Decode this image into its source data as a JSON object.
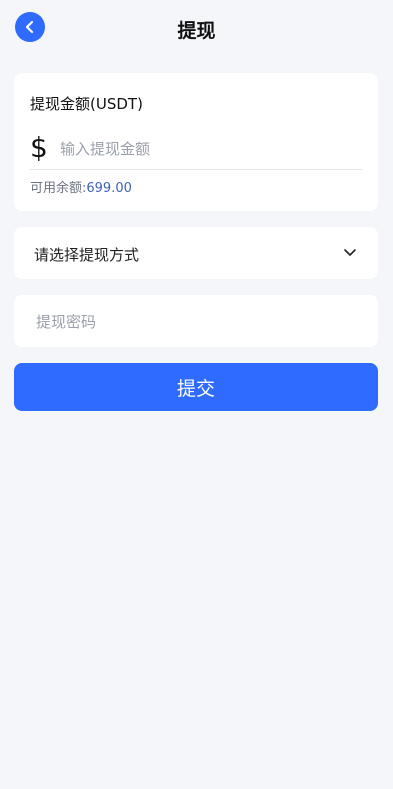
{
  "header": {
    "title": "提现",
    "back_icon": "chevron-left-icon"
  },
  "amount": {
    "label": "提现金额(USDT)",
    "currency_symbol": "$",
    "placeholder": "输入提现金额",
    "value": "",
    "available_label": "可用余额:",
    "available_value": "699.00"
  },
  "method": {
    "label": "请选择提现方式",
    "icon": "chevron-down-icon"
  },
  "password": {
    "placeholder": "提现密码",
    "value": ""
  },
  "submit": {
    "label": "提交"
  },
  "colors": {
    "accent": "#2f6bff",
    "background": "#f4f6fa",
    "balance": "#3d63b8"
  }
}
